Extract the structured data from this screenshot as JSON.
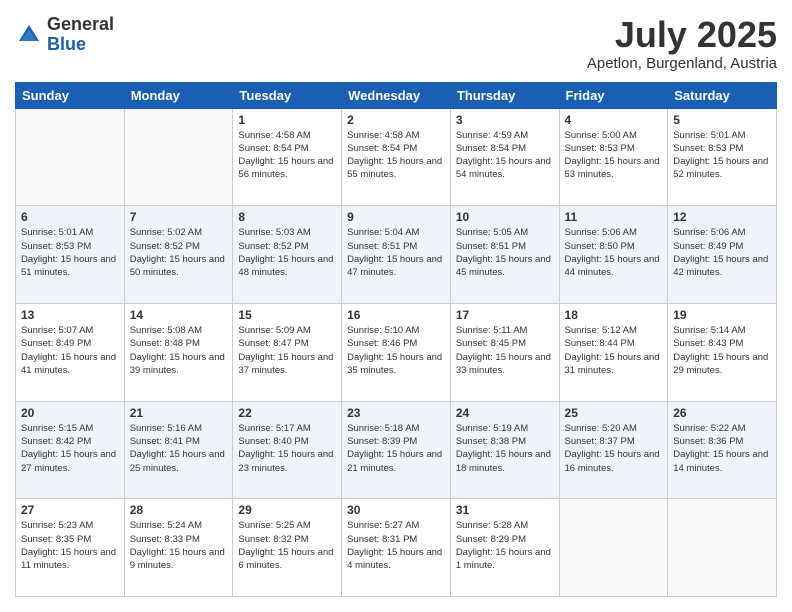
{
  "logo": {
    "general": "General",
    "blue": "Blue"
  },
  "title": {
    "month": "July 2025",
    "location": "Apetlon, Burgenland, Austria"
  },
  "headers": [
    "Sunday",
    "Monday",
    "Tuesday",
    "Wednesday",
    "Thursday",
    "Friday",
    "Saturday"
  ],
  "weeks": [
    [
      {
        "day": "",
        "sunrise": "",
        "sunset": "",
        "daylight": ""
      },
      {
        "day": "",
        "sunrise": "",
        "sunset": "",
        "daylight": ""
      },
      {
        "day": "1",
        "sunrise": "Sunrise: 4:58 AM",
        "sunset": "Sunset: 8:54 PM",
        "daylight": "Daylight: 15 hours and 56 minutes."
      },
      {
        "day": "2",
        "sunrise": "Sunrise: 4:58 AM",
        "sunset": "Sunset: 8:54 PM",
        "daylight": "Daylight: 15 hours and 55 minutes."
      },
      {
        "day": "3",
        "sunrise": "Sunrise: 4:59 AM",
        "sunset": "Sunset: 8:54 PM",
        "daylight": "Daylight: 15 hours and 54 minutes."
      },
      {
        "day": "4",
        "sunrise": "Sunrise: 5:00 AM",
        "sunset": "Sunset: 8:53 PM",
        "daylight": "Daylight: 15 hours and 53 minutes."
      },
      {
        "day": "5",
        "sunrise": "Sunrise: 5:01 AM",
        "sunset": "Sunset: 8:53 PM",
        "daylight": "Daylight: 15 hours and 52 minutes."
      }
    ],
    [
      {
        "day": "6",
        "sunrise": "Sunrise: 5:01 AM",
        "sunset": "Sunset: 8:53 PM",
        "daylight": "Daylight: 15 hours and 51 minutes."
      },
      {
        "day": "7",
        "sunrise": "Sunrise: 5:02 AM",
        "sunset": "Sunset: 8:52 PM",
        "daylight": "Daylight: 15 hours and 50 minutes."
      },
      {
        "day": "8",
        "sunrise": "Sunrise: 5:03 AM",
        "sunset": "Sunset: 8:52 PM",
        "daylight": "Daylight: 15 hours and 48 minutes."
      },
      {
        "day": "9",
        "sunrise": "Sunrise: 5:04 AM",
        "sunset": "Sunset: 8:51 PM",
        "daylight": "Daylight: 15 hours and 47 minutes."
      },
      {
        "day": "10",
        "sunrise": "Sunrise: 5:05 AM",
        "sunset": "Sunset: 8:51 PM",
        "daylight": "Daylight: 15 hours and 45 minutes."
      },
      {
        "day": "11",
        "sunrise": "Sunrise: 5:06 AM",
        "sunset": "Sunset: 8:50 PM",
        "daylight": "Daylight: 15 hours and 44 minutes."
      },
      {
        "day": "12",
        "sunrise": "Sunrise: 5:06 AM",
        "sunset": "Sunset: 8:49 PM",
        "daylight": "Daylight: 15 hours and 42 minutes."
      }
    ],
    [
      {
        "day": "13",
        "sunrise": "Sunrise: 5:07 AM",
        "sunset": "Sunset: 8:49 PM",
        "daylight": "Daylight: 15 hours and 41 minutes."
      },
      {
        "day": "14",
        "sunrise": "Sunrise: 5:08 AM",
        "sunset": "Sunset: 8:48 PM",
        "daylight": "Daylight: 15 hours and 39 minutes."
      },
      {
        "day": "15",
        "sunrise": "Sunrise: 5:09 AM",
        "sunset": "Sunset: 8:47 PM",
        "daylight": "Daylight: 15 hours and 37 minutes."
      },
      {
        "day": "16",
        "sunrise": "Sunrise: 5:10 AM",
        "sunset": "Sunset: 8:46 PM",
        "daylight": "Daylight: 15 hours and 35 minutes."
      },
      {
        "day": "17",
        "sunrise": "Sunrise: 5:11 AM",
        "sunset": "Sunset: 8:45 PM",
        "daylight": "Daylight: 15 hours and 33 minutes."
      },
      {
        "day": "18",
        "sunrise": "Sunrise: 5:12 AM",
        "sunset": "Sunset: 8:44 PM",
        "daylight": "Daylight: 15 hours and 31 minutes."
      },
      {
        "day": "19",
        "sunrise": "Sunrise: 5:14 AM",
        "sunset": "Sunset: 8:43 PM",
        "daylight": "Daylight: 15 hours and 29 minutes."
      }
    ],
    [
      {
        "day": "20",
        "sunrise": "Sunrise: 5:15 AM",
        "sunset": "Sunset: 8:42 PM",
        "daylight": "Daylight: 15 hours and 27 minutes."
      },
      {
        "day": "21",
        "sunrise": "Sunrise: 5:16 AM",
        "sunset": "Sunset: 8:41 PM",
        "daylight": "Daylight: 15 hours and 25 minutes."
      },
      {
        "day": "22",
        "sunrise": "Sunrise: 5:17 AM",
        "sunset": "Sunset: 8:40 PM",
        "daylight": "Daylight: 15 hours and 23 minutes."
      },
      {
        "day": "23",
        "sunrise": "Sunrise: 5:18 AM",
        "sunset": "Sunset: 8:39 PM",
        "daylight": "Daylight: 15 hours and 21 minutes."
      },
      {
        "day": "24",
        "sunrise": "Sunrise: 5:19 AM",
        "sunset": "Sunset: 8:38 PM",
        "daylight": "Daylight: 15 hours and 18 minutes."
      },
      {
        "day": "25",
        "sunrise": "Sunrise: 5:20 AM",
        "sunset": "Sunset: 8:37 PM",
        "daylight": "Daylight: 15 hours and 16 minutes."
      },
      {
        "day": "26",
        "sunrise": "Sunrise: 5:22 AM",
        "sunset": "Sunset: 8:36 PM",
        "daylight": "Daylight: 15 hours and 14 minutes."
      }
    ],
    [
      {
        "day": "27",
        "sunrise": "Sunrise: 5:23 AM",
        "sunset": "Sunset: 8:35 PM",
        "daylight": "Daylight: 15 hours and 11 minutes."
      },
      {
        "day": "28",
        "sunrise": "Sunrise: 5:24 AM",
        "sunset": "Sunset: 8:33 PM",
        "daylight": "Daylight: 15 hours and 9 minutes."
      },
      {
        "day": "29",
        "sunrise": "Sunrise: 5:25 AM",
        "sunset": "Sunset: 8:32 PM",
        "daylight": "Daylight: 15 hours and 6 minutes."
      },
      {
        "day": "30",
        "sunrise": "Sunrise: 5:27 AM",
        "sunset": "Sunset: 8:31 PM",
        "daylight": "Daylight: 15 hours and 4 minutes."
      },
      {
        "day": "31",
        "sunrise": "Sunrise: 5:28 AM",
        "sunset": "Sunset: 8:29 PM",
        "daylight": "Daylight: 15 hours and 1 minute."
      },
      {
        "day": "",
        "sunrise": "",
        "sunset": "",
        "daylight": ""
      },
      {
        "day": "",
        "sunrise": "",
        "sunset": "",
        "daylight": ""
      }
    ]
  ]
}
